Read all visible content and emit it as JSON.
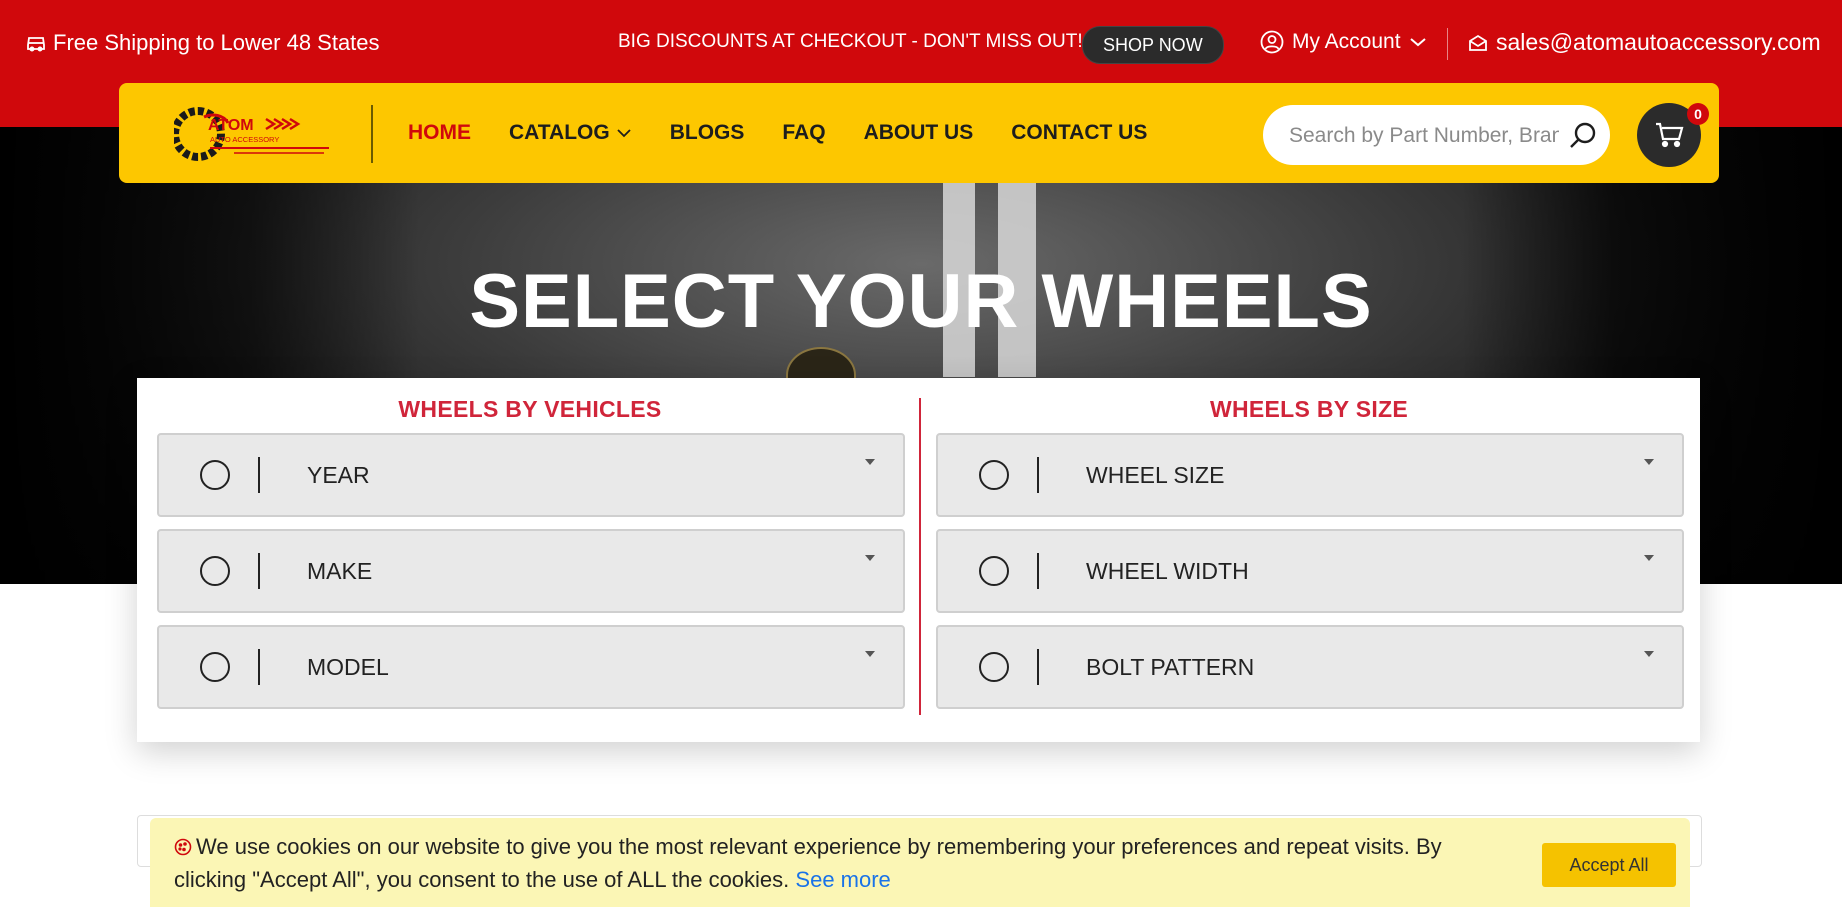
{
  "topbar": {
    "shipping_icon": "truck-icon",
    "shipping_text": "Free Shipping to Lower 48 States",
    "promo_text": "BIG DISCOUNTS AT CHECKOUT - DON'T MISS OUT!",
    "shop_now_label": "SHOP NOW",
    "account_icon": "user-circle-icon",
    "account_label": "My Account",
    "email_icon": "mail-icon",
    "email": "sales@atomautoaccessory.com",
    "bg_color": "#d0080c"
  },
  "navbar": {
    "logo_alt": "Atom Auto Accessory",
    "logo_word": "ATOM",
    "logo_sub": "AUTO ACCESSORY",
    "bg_color": "#fdc700",
    "links": [
      {
        "label": "HOME",
        "active": true
      },
      {
        "label": "CATALOG",
        "has_dropdown": true
      },
      {
        "label": "BLOGS"
      },
      {
        "label": "FAQ"
      },
      {
        "label": "ABOUT US"
      },
      {
        "label": "CONTACT US"
      }
    ],
    "search_placeholder": "Search by Part Number, Brand...",
    "search_icon": "search-icon",
    "cart_icon": "cart-icon",
    "cart_count": "0"
  },
  "hero": {
    "title": "SELECT YOUR WHEELS"
  },
  "wheels_panel": {
    "by_vehicles": {
      "heading": "WHEELS BY VEHICLES",
      "fields": [
        "YEAR",
        "MAKE",
        "MODEL"
      ]
    },
    "by_size": {
      "heading": "WHEELS BY SIZE",
      "fields": [
        "WHEEL SIZE",
        "WHEEL WIDTH",
        "BOLT PATTERN"
      ]
    },
    "accent_color": "#d0253a"
  },
  "cookie_banner": {
    "icon": "cookie-icon",
    "text": "We use cookies on our website to give you the most relevant experience by remembering your preferences and repeat visits. By clicking \"Accept All\", you consent to the use of ALL the cookies.",
    "see_more_label": "See more",
    "accept_label": "Accept All"
  }
}
